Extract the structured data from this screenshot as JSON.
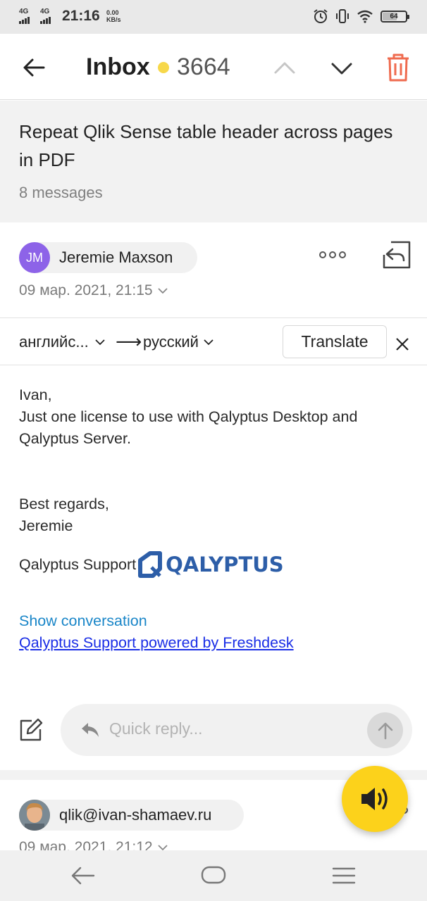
{
  "status_bar": {
    "net1": "4G",
    "net2": "4G",
    "time": "21:16",
    "speed_value": "0.00",
    "speed_unit": "KB/s",
    "battery": "64"
  },
  "header": {
    "title": "Inbox",
    "unread_count": "3664",
    "unread_dot_color": "#f7d84a",
    "icons": [
      "back-arrow-icon",
      "chevron-up-icon",
      "chevron-down-icon",
      "trash-icon"
    ]
  },
  "thread": {
    "subject": "Repeat Qlik Sense table header across pages in PDF",
    "message_count": "8 messages"
  },
  "message": {
    "avatar_initials": "JM",
    "avatar_color": "#8d63e8",
    "sender": "Jeremie Maxson",
    "date": "09 мар. 2021, 21:15",
    "body": {
      "greeting": "Ivan,",
      "line": "Just one license to use with Qalyptus Desktop and Qalyptus Server.",
      "regards": "Best regards,",
      "name": "Jeremie",
      "support": "Qalyptus Support",
      "logo_text": "QALYPTUS"
    },
    "show_conversation": "Show conversation",
    "powered_by": "Qalyptus Support powered by Freshdesk"
  },
  "translate": {
    "from": "английс...",
    "arrow": "⟶",
    "to": "русский",
    "button": "Translate"
  },
  "quick_reply": {
    "placeholder": "Quick reply..."
  },
  "message2": {
    "sender": "qlik@ivan-shamaev.ru",
    "date": "09 мар. 2021, 21:12"
  },
  "fab": {
    "icon": "speaker-icon",
    "color": "#fcd21b"
  }
}
